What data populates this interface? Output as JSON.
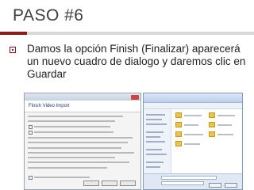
{
  "slide": {
    "title": "PASO #6",
    "bullet": "Damos la opción Finish (Finalizar) aparecerá un nuevo cuadro de dialogo y daremos clic en Guardar",
    "accent_color": "#8c1b1b"
  },
  "screenshot": {
    "wizard_title": "Finish Video Import"
  }
}
